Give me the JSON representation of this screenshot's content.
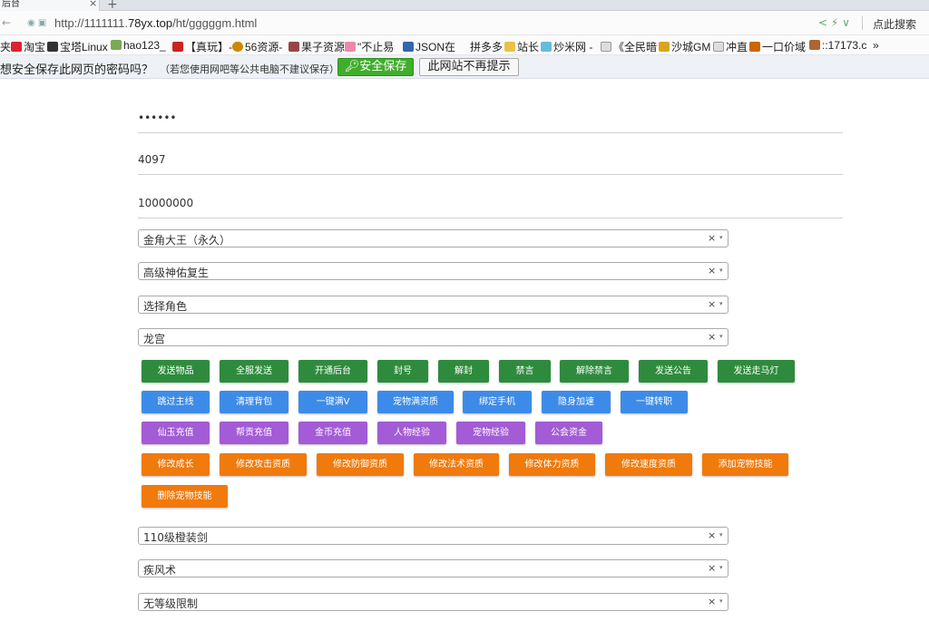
{
  "browser": {
    "tab_title": "后台",
    "url_prefix": "http://1111111.",
    "url_host": "78yx.top",
    "url_path": "/ht/gggggm.html",
    "search_label": "点此搜索",
    "bookmarks": [
      "夹",
      "淘宝",
      "宝塔Linux",
      "hao123_",
      "【真玩】-",
      "56资源-",
      "果子资源",
      "\"不止易",
      "JSON在",
      "拼多多",
      "站长",
      "炒米网 -",
      "《全民暗",
      "沙城GM",
      "冲直",
      "一口价域",
      "::17173.c",
      "»"
    ]
  },
  "password_bar": {
    "prompt": "想安全保存此网页的密码吗？",
    "note": "（若您使用网吧等公共电脑不建议保存）",
    "save_label": "安全保存",
    "never_label": "此网站不再提示"
  },
  "form": {
    "password_mask": "••••••",
    "role_id": "4097",
    "amount": "10000000",
    "select1": "金角大王（永久）",
    "select2": "高级神佑复生",
    "select3": "选择角色",
    "select4": "龙宫",
    "select5": "110级橙装剑",
    "select6": "疾风术",
    "select7": "无等级限制"
  },
  "buttons": {
    "row1": [
      "发送物品",
      "全服发送",
      "开通后台",
      "封号",
      "解封",
      "禁言",
      "解除禁言",
      "发送公告",
      "发送走马灯"
    ],
    "row2": [
      "跳过主线",
      "清理背包",
      "一键满V",
      "宠物满资质",
      "绑定手机",
      "隐身加速",
      "一键转职"
    ],
    "row3": [
      "仙玉充值",
      "帮贡充值",
      "金币充值",
      "人物经验",
      "宠物经验",
      "公会资金"
    ],
    "row4": [
      "修改成长",
      "修改攻击资质",
      "修改防御资质",
      "修改法术资质",
      "修改体力资质",
      "修改速度资质",
      "添加宠物技能"
    ],
    "row5": [
      "删除宠物技能"
    ]
  },
  "colors": {
    "green": "#2e8b3d",
    "blue": "#3d8be8",
    "purple": "#a35bd6",
    "orange": "#f07a0c",
    "save_green": "#3fae2b"
  },
  "icons": {
    "clear": "×",
    "dropdown": "▾",
    "close": "×",
    "new_tab": "+",
    "key": "🔑"
  }
}
